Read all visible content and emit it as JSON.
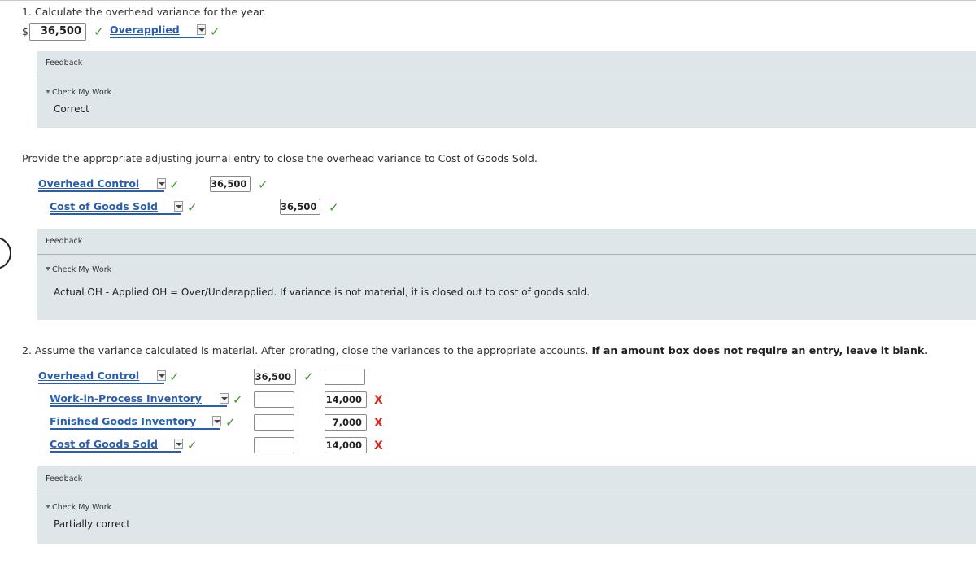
{
  "part1": {
    "question": "1. Calculate the overhead variance for the year.",
    "currency": "$",
    "amount": "36,500",
    "variance_type": "Overapplied",
    "feedback": {
      "label": "Feedback",
      "check_my_work": "Check My Work",
      "message": "Correct"
    }
  },
  "journal1": {
    "instruction": "Provide the appropriate adjusting journal entry to close the overhead variance to Cost of Goods Sold.",
    "rows": [
      {
        "account": "Overhead Control",
        "debit": "36,500",
        "credit": ""
      },
      {
        "account": "Cost of Goods Sold",
        "debit": "",
        "credit": "36,500"
      }
    ],
    "feedback": {
      "label": "Feedback",
      "check_my_work": "Check My Work",
      "message": "Actual OH - Applied OH = Over/Underapplied. If variance is not material, it is closed out to cost of goods sold."
    }
  },
  "part2": {
    "question_main": "2. Assume the variance calculated is material. After prorating, close the variances to the appropriate accounts. ",
    "question_bold": "If an amount box does not require an entry, leave it blank.",
    "rows": [
      {
        "account": "Overhead Control",
        "debit": "36,500",
        "credit": ""
      },
      {
        "account": "Work-in-Process Inventory",
        "debit": "",
        "credit": "14,000"
      },
      {
        "account": "Finished Goods Inventory",
        "debit": "",
        "credit": "7,000"
      },
      {
        "account": "Cost of Goods Sold",
        "debit": "",
        "credit": "14,000"
      }
    ],
    "feedback": {
      "label": "Feedback",
      "check_my_work": "Check My Work",
      "message": "Partially correct"
    }
  },
  "marks": {
    "check": "✓",
    "cross": "X"
  }
}
